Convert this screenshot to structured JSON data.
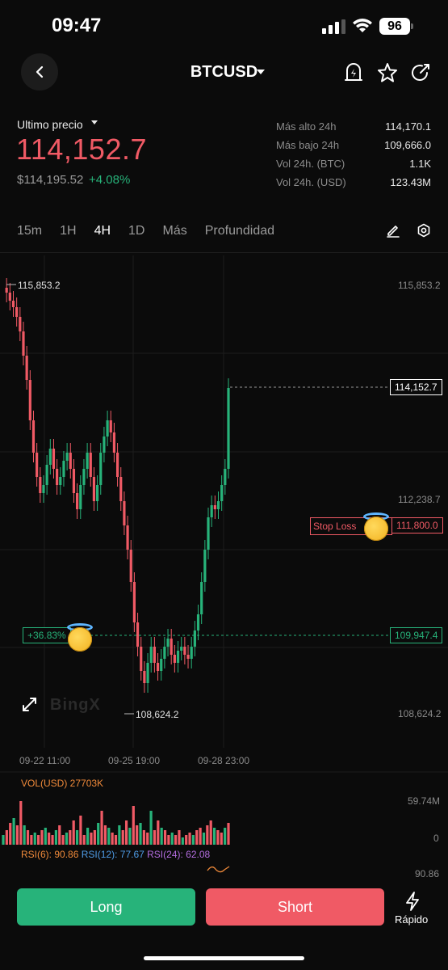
{
  "status": {
    "time": "09:47",
    "battery": "96"
  },
  "header": {
    "title": "BTCUSD"
  },
  "price": {
    "label": "Ultimo precio",
    "last": "114,152.7",
    "usd": "$114,195.52",
    "change": "+4.08%"
  },
  "stats": [
    {
      "label": "Más alto 24h",
      "value": "114,170.1"
    },
    {
      "label": "Más bajo 24h",
      "value": "109,666.0"
    },
    {
      "label": "Vol 24h. (BTC)",
      "value": "1.1K"
    },
    {
      "label": "Vol 24h. (USD)",
      "value": "123.43M"
    }
  ],
  "tabs": [
    "15m",
    "1H",
    "4H",
    "1D",
    "Más",
    "Profundidad"
  ],
  "active_tab": "4H",
  "chart": {
    "high_label": "115,853.2",
    "low_label": "108,624.2",
    "right_axis": [
      "115,853.2",
      "112,238.7",
      "108,624.2"
    ],
    "current_price": "114,152.7",
    "stop_loss_label": "Stop Loss",
    "stop_loss_price": "111,800.0",
    "position_pnl": "+36.83%",
    "position_price": "109,947.4",
    "x_labels": [
      "09-22 11:00",
      "09-25 19:00",
      "09-28 23:00"
    ],
    "watermark": "BingX"
  },
  "volume": {
    "label": "VOL(USD) 27703K",
    "axis_top": "59.74M",
    "axis_zero": "0"
  },
  "rsi": {
    "rsi6_label": "RSI(6):",
    "rsi6": "90.86",
    "rsi12_label": "RSI(12):",
    "rsi12": "77.67",
    "rsi24_label": "RSI(24):",
    "rsi24": "62.08",
    "axis": "90.86"
  },
  "buttons": {
    "long": "Long",
    "short": "Short",
    "rapido": "Rápido"
  },
  "colors": {
    "up": "#27b37a",
    "down": "#f05a65",
    "bg": "#0b0b0b"
  }
}
